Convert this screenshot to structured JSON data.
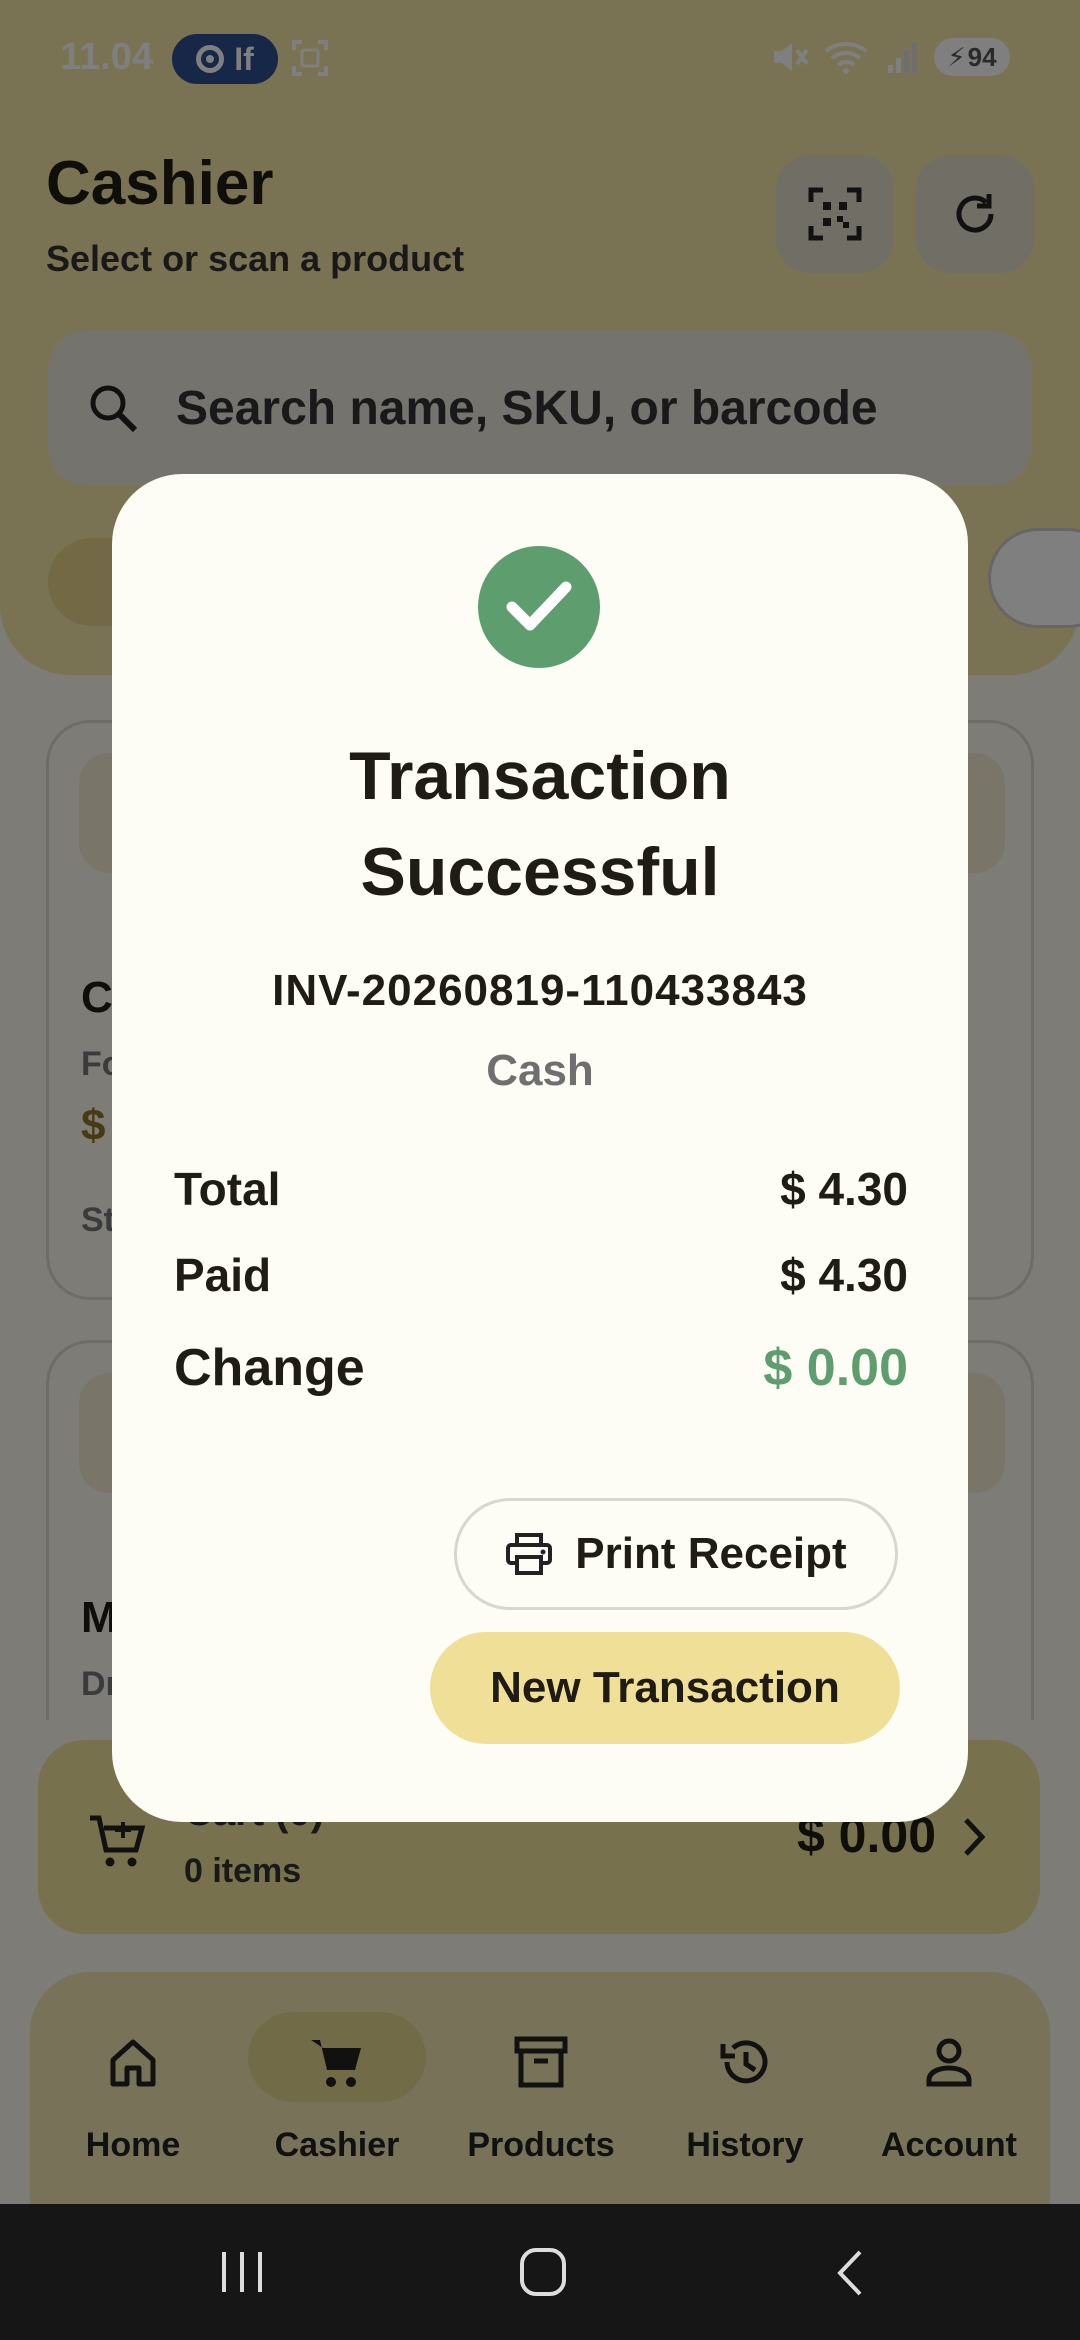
{
  "status_bar": {
    "time": "11.04",
    "pill_label": "If",
    "battery": "94"
  },
  "header": {
    "title": "Cashier",
    "subtitle": "Select or scan a product",
    "qr_icon": "qr-code-icon",
    "refresh_icon": "refresh-icon"
  },
  "search": {
    "placeholder": "Search name, SKU, or barcode"
  },
  "background_cards": [
    {
      "name_fragment": "C",
      "category_fragment": "Fo",
      "price_fragment": "$",
      "stock_fragment": "St"
    },
    {
      "name_fragment": "M",
      "category_fragment": "Dr"
    }
  ],
  "cart": {
    "title": "Cart (0)",
    "items": "0 items",
    "total": "$ 0.00"
  },
  "nav": {
    "items": [
      {
        "label": "Home",
        "icon": "home-icon"
      },
      {
        "label": "Cashier",
        "icon": "cart-icon",
        "active": true
      },
      {
        "label": "Products",
        "icon": "archive-box-icon"
      },
      {
        "label": "History",
        "icon": "history-icon"
      },
      {
        "label": "Account",
        "icon": "person-icon"
      }
    ]
  },
  "dialog": {
    "title_line1": "Transaction",
    "title_line2": "Successful",
    "invoice": "INV-20260819-110433843",
    "payment_method": "Cash",
    "rows": [
      {
        "label": "Total",
        "value": "$ 4.30"
      },
      {
        "label": "Paid",
        "value": "$ 4.30"
      },
      {
        "label": "Change",
        "value": "$ 0.00"
      }
    ],
    "print_label": "Print Receipt",
    "new_label": "New Transaction"
  },
  "colors": {
    "accent_yellow": "#F0E097",
    "success_green": "#5E9E6E",
    "dialog_bg": "#FDFCF5"
  }
}
